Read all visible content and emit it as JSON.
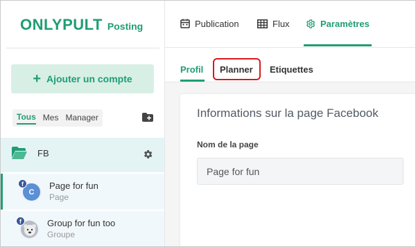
{
  "brand": {
    "name": "ONLYPULT",
    "product": "Posting"
  },
  "sidebar": {
    "add_account_label": "Ajouter un compte",
    "filters": [
      "Tous",
      "Mes",
      "Manager"
    ],
    "active_filter": "Tous",
    "group": {
      "label": "FB"
    },
    "pages": [
      {
        "title": "Page for fun",
        "type": "Page",
        "avatar_letter": "C",
        "network": "f"
      },
      {
        "title": "Group for fun too",
        "type": "Groupe",
        "avatar_letter": "",
        "network": "f"
      }
    ]
  },
  "topnav": {
    "items": [
      {
        "label": "Publication",
        "icon": "calendar-icon"
      },
      {
        "label": "Flux",
        "icon": "grid-icon"
      },
      {
        "label": "Paramètres",
        "icon": "gear-icon"
      }
    ],
    "active": "Paramètres"
  },
  "subtabs": {
    "items": [
      "Profil",
      "Planner",
      "Etiquettes"
    ],
    "active": "Profil",
    "highlighted": "Planner"
  },
  "card": {
    "title": "Informations sur la page Facebook",
    "field_label": "Nom de la page",
    "field_value": "Page for fun"
  },
  "colors": {
    "accent": "#1f9d74",
    "highlight": "#d9161c",
    "facebook": "#3b5998"
  }
}
